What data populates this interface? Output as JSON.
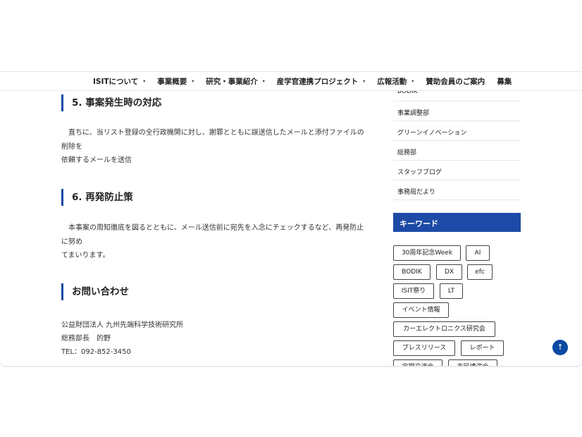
{
  "nav": {
    "items": [
      {
        "label": "ISITについて",
        "caret": "▾"
      },
      {
        "label": "事業概要",
        "caret": "▾"
      },
      {
        "label": "研究・事業紹介",
        "caret": "▾"
      },
      {
        "label": "産学官連携プロジェクト",
        "caret": "▾"
      },
      {
        "label": "広報活動",
        "caret": "▾"
      },
      {
        "label": "賛助会員のご案内"
      },
      {
        "label": "募集"
      }
    ]
  },
  "main": {
    "section5": {
      "heading": "5. 事案発生時の対応",
      "line1": "直ちに、当リスト登録の全行政機関に対し、謝罪とともに誤送信したメールと添付ファイルの削除を",
      "line2": "依頼するメールを送信"
    },
    "section6": {
      "heading": "6. 再発防止策",
      "line1": "本事案の周知徹底を図るとともに、メール送信前に宛先を入念にチェックするなど、再発防止に努め",
      "line2": "てまいります。"
    },
    "contact": {
      "heading": "お問い合わせ",
      "org": "公益財団法人 九州先端科学技術研究所",
      "person": "総務部長　的野",
      "tel": "TEL：092-852-3450"
    }
  },
  "sidebar": {
    "categories": [
      "BODIK",
      "事業調整部",
      "グリーンイノベーション",
      "総務部",
      "スタッフブログ",
      "事務局だより"
    ],
    "keyword_heading": "キーワード",
    "keywords": [
      "30周年記念Week",
      "AI",
      "BODIK",
      "DX",
      "efc",
      "ISIT祭り",
      "LT",
      "イベント情報",
      "カーエレクトロニクス研究会",
      "プレスリリース",
      "レポート",
      "定期交流会",
      "市民講演会"
    ]
  },
  "back_to_top": "↑",
  "colors": {
    "accent": "#0b4aa2",
    "keyword_header": "#1d4aa6"
  }
}
